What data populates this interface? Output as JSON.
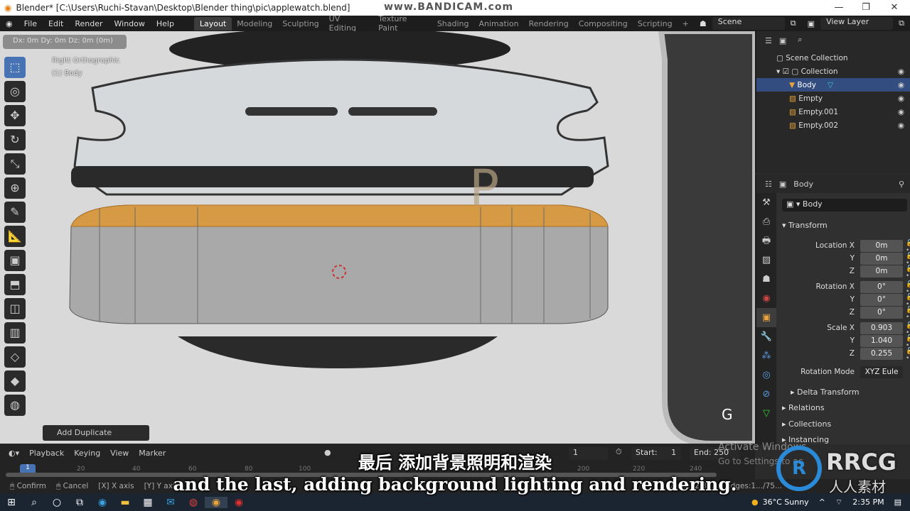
{
  "window": {
    "title": "Blender* [C:\\Users\\Ruchi-Stavan\\Desktop\\Blender thing\\pic\\applewatch.blend]",
    "recorder_watermark": "www.BANDICAM.com",
    "minimize": "—",
    "maximize": "❐",
    "close": "✕"
  },
  "menu": {
    "items": [
      "File",
      "Edit",
      "Render",
      "Window",
      "Help"
    ],
    "workspaces": [
      "Layout",
      "Modeling",
      "Sculpting",
      "UV Editing",
      "Texture Paint",
      "Shading",
      "Animation",
      "Rendering",
      "Compositing",
      "Scripting",
      "+"
    ],
    "active_workspace": "Layout",
    "scene": "Scene",
    "view_layer": "View Layer"
  },
  "viewport": {
    "operator_hint": "Dx: 0m  Dy: 0m  Dz: 0m (0m)",
    "view_name": "Right Orthographic",
    "object_name": "(1) Body",
    "last_operator": "Add Duplicate",
    "reference_letters": "P",
    "overlay_key": "G"
  },
  "outliner": {
    "search_placeholder": "",
    "items": [
      {
        "label": "Scene Collection",
        "indent": 0,
        "icon": "collection-icon"
      },
      {
        "label": "Collection",
        "indent": 1,
        "icon": "collection-icon"
      },
      {
        "label": "Body",
        "indent": 2,
        "icon": "mesh-icon",
        "selected": true
      },
      {
        "label": "Empty",
        "indent": 2,
        "icon": "empty-image-icon"
      },
      {
        "label": "Empty.001",
        "indent": 2,
        "icon": "empty-image-icon"
      },
      {
        "label": "Empty.002",
        "indent": 2,
        "icon": "empty-image-icon"
      }
    ]
  },
  "properties": {
    "header": "Body",
    "object_name": "Body",
    "transform_label": "Transform",
    "rows": [
      {
        "label": "Location X",
        "value": "0m"
      },
      {
        "label": "Y",
        "value": "0m"
      },
      {
        "label": "Z",
        "value": "0m"
      },
      {
        "label": "Rotation X",
        "value": "0°"
      },
      {
        "label": "Y",
        "value": "0°"
      },
      {
        "label": "Z",
        "value": "0°"
      },
      {
        "label": "Scale X",
        "value": "0.903"
      },
      {
        "label": "Y",
        "value": "1.040"
      },
      {
        "label": "Z",
        "value": "0.255"
      }
    ],
    "rotation_mode_label": "Rotation Mode",
    "rotation_mode": "XYZ Eule",
    "sections": [
      "Delta Transform",
      "Relations",
      "Collections",
      "Instancing"
    ]
  },
  "timeline": {
    "menus": [
      "Playback",
      "Keying",
      "View",
      "Marker"
    ],
    "current_frame": "1",
    "start_label": "Start:",
    "start": "1",
    "end_label": "End:",
    "end": "250",
    "ticks": [
      "1",
      "20",
      "40",
      "60",
      "80",
      "100",
      "200",
      "220",
      "240"
    ]
  },
  "status": {
    "items": [
      "Confirm",
      "Cancel",
      "X axis",
      "Y axis"
    ],
    "stats": "Verts:92/36... | Edges:1.../75..."
  },
  "activation": {
    "line1": "Activate Windows",
    "line2": "Go to Settings to activate Windows."
  },
  "subtitles": {
    "zh": "最后 添加背景照明和渲染",
    "en": "and the last, adding background lighting and rendering."
  },
  "branding": {
    "name": "RRCG",
    "sub": "人人素材"
  },
  "taskbar": {
    "weather": "36°C  Sunny",
    "time": "2:35 PM"
  },
  "colors": {
    "accent": "#4772b3",
    "selection": "#334d80",
    "object_orange": "#e8a33a"
  }
}
